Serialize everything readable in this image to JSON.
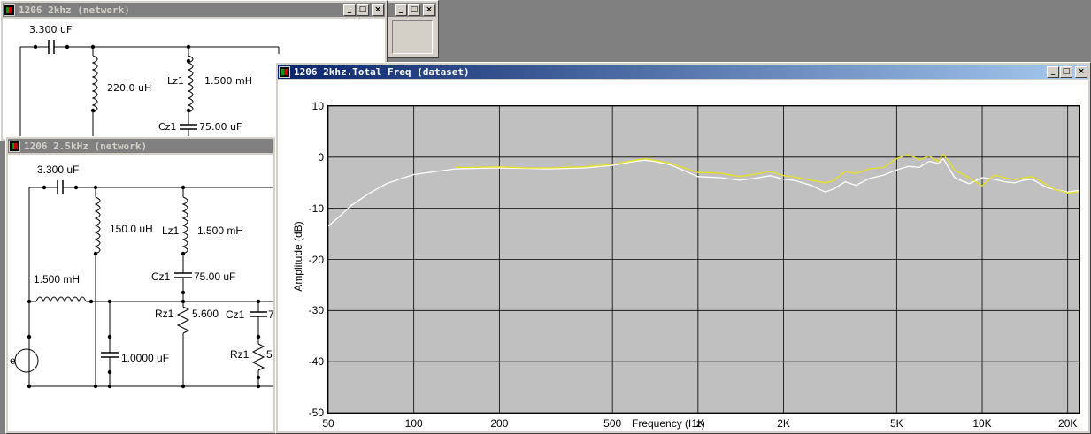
{
  "windows": {
    "back": {
      "controls": [
        "_",
        "□",
        "×"
      ]
    },
    "net2k": {
      "title": "1206 2khz (network)",
      "controls": [
        "_",
        "□",
        "×"
      ],
      "labels": {
        "c_series": "3.300 uF",
        "l_shunt": "220.0 uH",
        "lz_name": "Lz1",
        "lz_value": "1.500 mH",
        "cz_name": "Cz1",
        "cz_value": "75.00 uF"
      }
    },
    "net25k": {
      "title": "1206 2.5kHz (network)",
      "labels": {
        "c_series": "3.300 uF",
        "l_shunt": "150.0 uH",
        "lz_name": "Lz1",
        "lz_value": "1.500 mH",
        "cz_name": "Cz1",
        "cz_value": "75.00 uF",
        "l_series": "1.500 mH",
        "c_shunt": "1.0000 uF",
        "rz_name": "Rz1",
        "rz_value": "5.600",
        "cz2_name": "Cz1",
        "cz2_value": "7",
        "rz2_name": "Rz1",
        "rz2_value": "5",
        "source": "e"
      }
    },
    "freq": {
      "title": "1206 2khz.Total Freq (dataset)",
      "controls": [
        "_",
        "□",
        "×"
      ]
    }
  },
  "chart_data": {
    "type": "line",
    "title": "",
    "xlabel": "Frequency (Hz)",
    "ylabel": "Amplitude (dB)",
    "xscale": "log",
    "xlim": [
      50,
      22000
    ],
    "ylim": [
      -50,
      10
    ],
    "x_ticks": [
      50,
      100,
      200,
      500,
      1000,
      2000,
      5000,
      10000,
      20000
    ],
    "x_tick_labels": [
      "50",
      "100",
      "200",
      "500",
      "1K",
      "2K",
      "5K",
      "10K",
      "20K"
    ],
    "y_ticks": [
      10,
      0,
      -10,
      -20,
      -30,
      -40,
      -50
    ],
    "grid": true,
    "background": "#c0c0c0",
    "series": [
      {
        "color": "#ffffff",
        "x": [
          50,
          55,
          60,
          70,
          80,
          90,
          100,
          120,
          140,
          160,
          200,
          250,
          300,
          400,
          500,
          600,
          650,
          700,
          800,
          1000,
          1200,
          1400,
          1600,
          1800,
          2000,
          2200,
          2500,
          2800,
          3000,
          3300,
          3600,
          4000,
          4500,
          5000,
          5500,
          6000,
          6500,
          7000,
          7300,
          8000,
          9000,
          10000,
          11000,
          12000,
          13000,
          14000,
          15000,
          16000,
          17000,
          18000,
          20000,
          22000
        ],
        "y": [
          -13.5,
          -11.5,
          -9.5,
          -7,
          -5.2,
          -4.2,
          -3.4,
          -2.8,
          -2.3,
          -2.2,
          -2.1,
          -2.2,
          -2.3,
          -2.1,
          -1.6,
          -0.8,
          -0.6,
          -0.8,
          -1.5,
          -3.8,
          -4,
          -4.5,
          -4.1,
          -3.6,
          -4.3,
          -4.6,
          -5.5,
          -6.8,
          -6.2,
          -4.8,
          -5.5,
          -4.2,
          -3.5,
          -2.5,
          -1.8,
          -2,
          -0.8,
          -1.2,
          -0.3,
          -4,
          -5.2,
          -4,
          -4.3,
          -4.8,
          -5,
          -4.5,
          -4.3,
          -5.2,
          -6,
          -6.3,
          -6.8,
          -6.5
        ]
      },
      {
        "color": "#e8e020",
        "x": [
          140,
          160,
          200,
          250,
          300,
          400,
          500,
          600,
          650,
          700,
          800,
          1000,
          1200,
          1400,
          1600,
          1800,
          2000,
          2200,
          2500,
          2800,
          3000,
          3300,
          3600,
          4000,
          4500,
          5000,
          5500,
          6000,
          6500,
          7000,
          7300,
          8000,
          9000,
          10000,
          11000,
          12000,
          13000,
          14000,
          15000,
          16000,
          17000,
          18000,
          20000,
          22000
        ],
        "y": [
          -2,
          -2,
          -1.9,
          -2.1,
          -2.1,
          -1.9,
          -1.4,
          -0.6,
          -0.3,
          -0.6,
          -1.2,
          -3,
          -3.1,
          -3.8,
          -3.3,
          -2.8,
          -3.6,
          -3.9,
          -4.5,
          -5,
          -4.6,
          -2.8,
          -3.2,
          -2.3,
          -2,
          -0.3,
          0.5,
          -0.5,
          0.2,
          -0.8,
          0.6,
          -2.5,
          -4,
          -5.6,
          -3.5,
          -4,
          -4.4,
          -4,
          -3.8,
          -4.6,
          -5.5,
          -6.3,
          -7,
          -6.8
        ]
      }
    ]
  }
}
